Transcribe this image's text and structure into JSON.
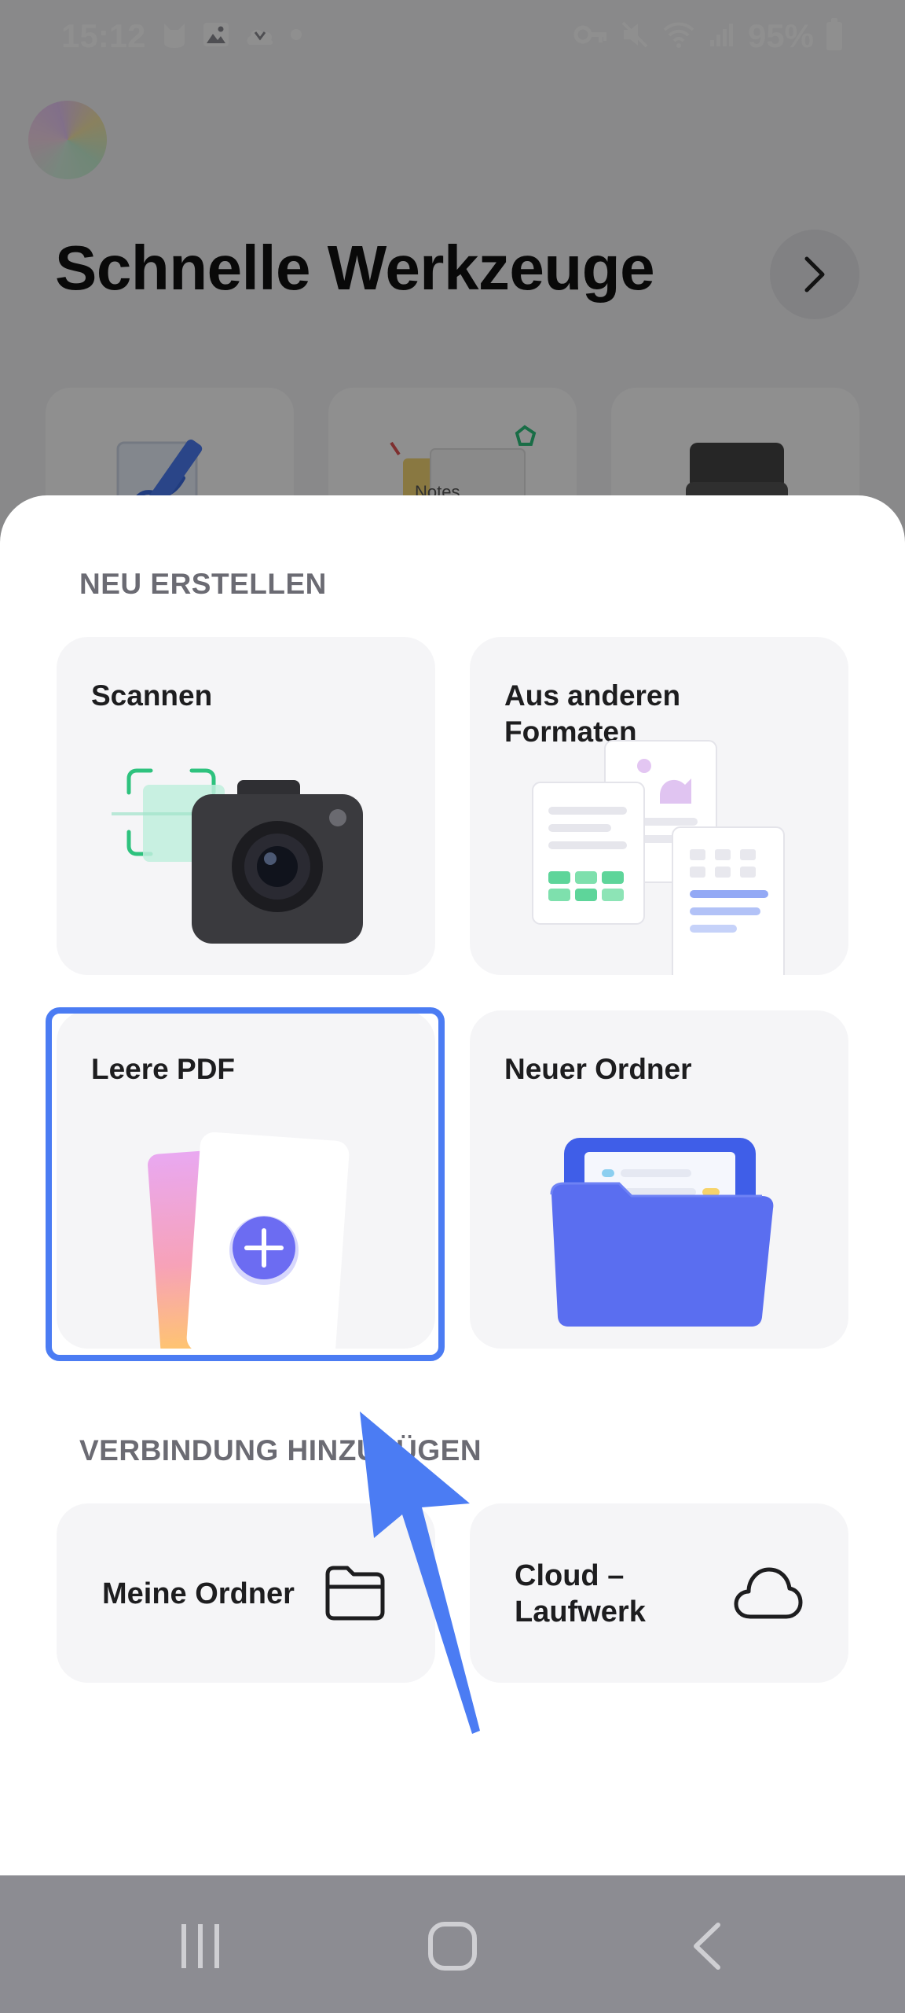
{
  "status_bar": {
    "time": "15:12",
    "battery": "95%",
    "icons": [
      "cat-icon",
      "gallery-icon",
      "cloud-download-icon",
      "dot-icon",
      "key-icon",
      "mute-icon",
      "wifi-icon",
      "signal-icon",
      "battery-icon"
    ]
  },
  "background": {
    "title": "Schnelle Werkzeuge"
  },
  "sheet": {
    "create_section_label": "NEU ERSTELLEN",
    "create_cards": [
      {
        "label": "Scannen"
      },
      {
        "label": "Aus anderen Formaten"
      },
      {
        "label": "Leere PDF"
      },
      {
        "label": "Neuer Ordner"
      }
    ],
    "connect_section_label": "VERBINDUNG HINZUFÜGEN",
    "connect_cards": [
      {
        "label": "Meine Ordner",
        "icon": "folder-icon"
      },
      {
        "label": "Cloud – Laufwerk",
        "icon": "cloud-icon"
      }
    ]
  },
  "annotation": {
    "arrow_color": "#4b7cf3",
    "highlight_color": "#4b7cf3"
  },
  "colors": {
    "accent": "#4b7cf3",
    "scan_green": "#2ec27e",
    "plus_purple": "#6c6cf2",
    "folder_blue": "#5a6ef0"
  }
}
